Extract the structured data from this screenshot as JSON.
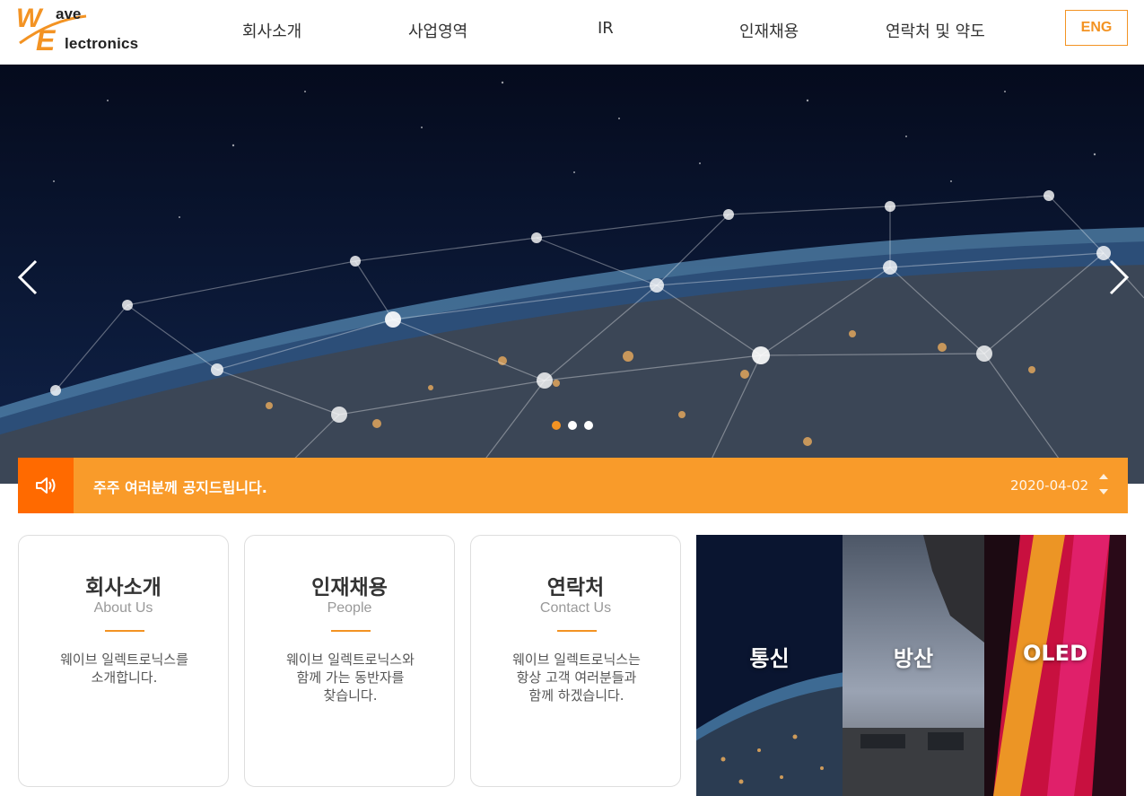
{
  "logo": {
    "part_ave": "ave",
    "part_lectronics": "lectronics",
    "mark_w": "W",
    "mark_e": "E"
  },
  "nav": {
    "items": [
      {
        "label": "회사소개"
      },
      {
        "label": "사업영역"
      },
      {
        "label": "IR"
      },
      {
        "label": "인재채용"
      },
      {
        "label": "연락처 및 약도"
      }
    ],
    "lang_button": "ENG"
  },
  "hero": {
    "slide_count": 3,
    "active_slide": 1,
    "prev_icon": "chevron-left-icon",
    "next_icon": "chevron-right-icon"
  },
  "notice": {
    "icon": "speaker-icon",
    "text": "주주 여러분께 공지드립니다.",
    "date": "2020-04-02"
  },
  "cards": [
    {
      "title": "회사소개",
      "subtitle": "About Us",
      "desc_lines": [
        "웨이브 일렉트로닉스를",
        "소개합니다."
      ]
    },
    {
      "title": "인재채용",
      "subtitle": "People",
      "desc_lines": [
        "웨이브 일렉트로닉스와",
        "함께 가는 동반자를",
        "찾습니다."
      ]
    },
    {
      "title": "연락처",
      "subtitle": "Contact Us",
      "desc_lines": [
        "웨이브 일렉트로닉스는",
        "항상 고객 여러분들과",
        "함께 하겠습니다."
      ]
    }
  ],
  "tiles": [
    {
      "label": "통신"
    },
    {
      "label": "방산"
    },
    {
      "label": "OLED"
    }
  ],
  "colors": {
    "accent": "#f39323",
    "notice_bg": "#f99b2a",
    "notice_icon_bg": "#ff6a00"
  }
}
